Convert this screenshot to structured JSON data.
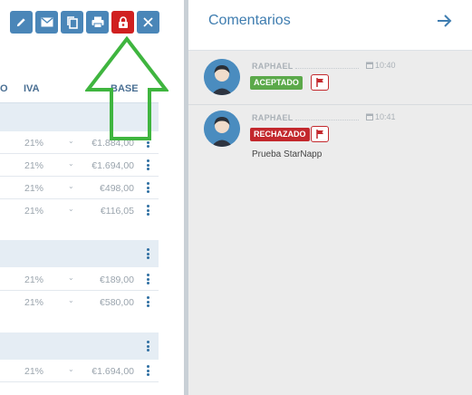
{
  "toolbar": {
    "buttons": [
      {
        "icon": "pencil-icon",
        "color": "#4a86b8"
      },
      {
        "icon": "envelope-icon",
        "color": "#4a86b8"
      },
      {
        "icon": "copy-icon",
        "color": "#4a86b8"
      },
      {
        "icon": "printer-icon",
        "color": "#4a86b8"
      },
      {
        "icon": "lock-icon",
        "color": "#d02020"
      },
      {
        "icon": "close-icon",
        "color": "#4a86b8"
      }
    ]
  },
  "table": {
    "headers": {
      "cut": "O",
      "iva": "IVA",
      "base": "BASE"
    },
    "groups": [
      {
        "rows": [
          {
            "iva": "21%",
            "base": "€1.884,00"
          },
          {
            "iva": "21%",
            "base": "€1.694,00"
          },
          {
            "iva": "21%",
            "base": "€498,00"
          },
          {
            "iva": "21%",
            "base": "€116,05"
          }
        ]
      },
      {
        "rows": [
          {
            "iva": "21%",
            "base": "€189,00"
          },
          {
            "iva": "21%",
            "base": "€580,00"
          }
        ]
      },
      {
        "rows": [
          {
            "iva": "21%",
            "base": "€1.694,00"
          }
        ]
      }
    ]
  },
  "comments_panel": {
    "title": "Comentarios",
    "comments": [
      {
        "author": "RAPHAEL",
        "time": "10:40",
        "status": "ACEPTADO",
        "text": ""
      },
      {
        "author": "RAPHAEL",
        "time": "10:41",
        "status": "RECHAZADO",
        "text": "Prueba StarNapp"
      }
    ]
  },
  "colors": {
    "accent": "#4a86b8",
    "danger": "#c3282d",
    "success": "#5ba94a",
    "annotation_arrow": "#3fb53f"
  }
}
